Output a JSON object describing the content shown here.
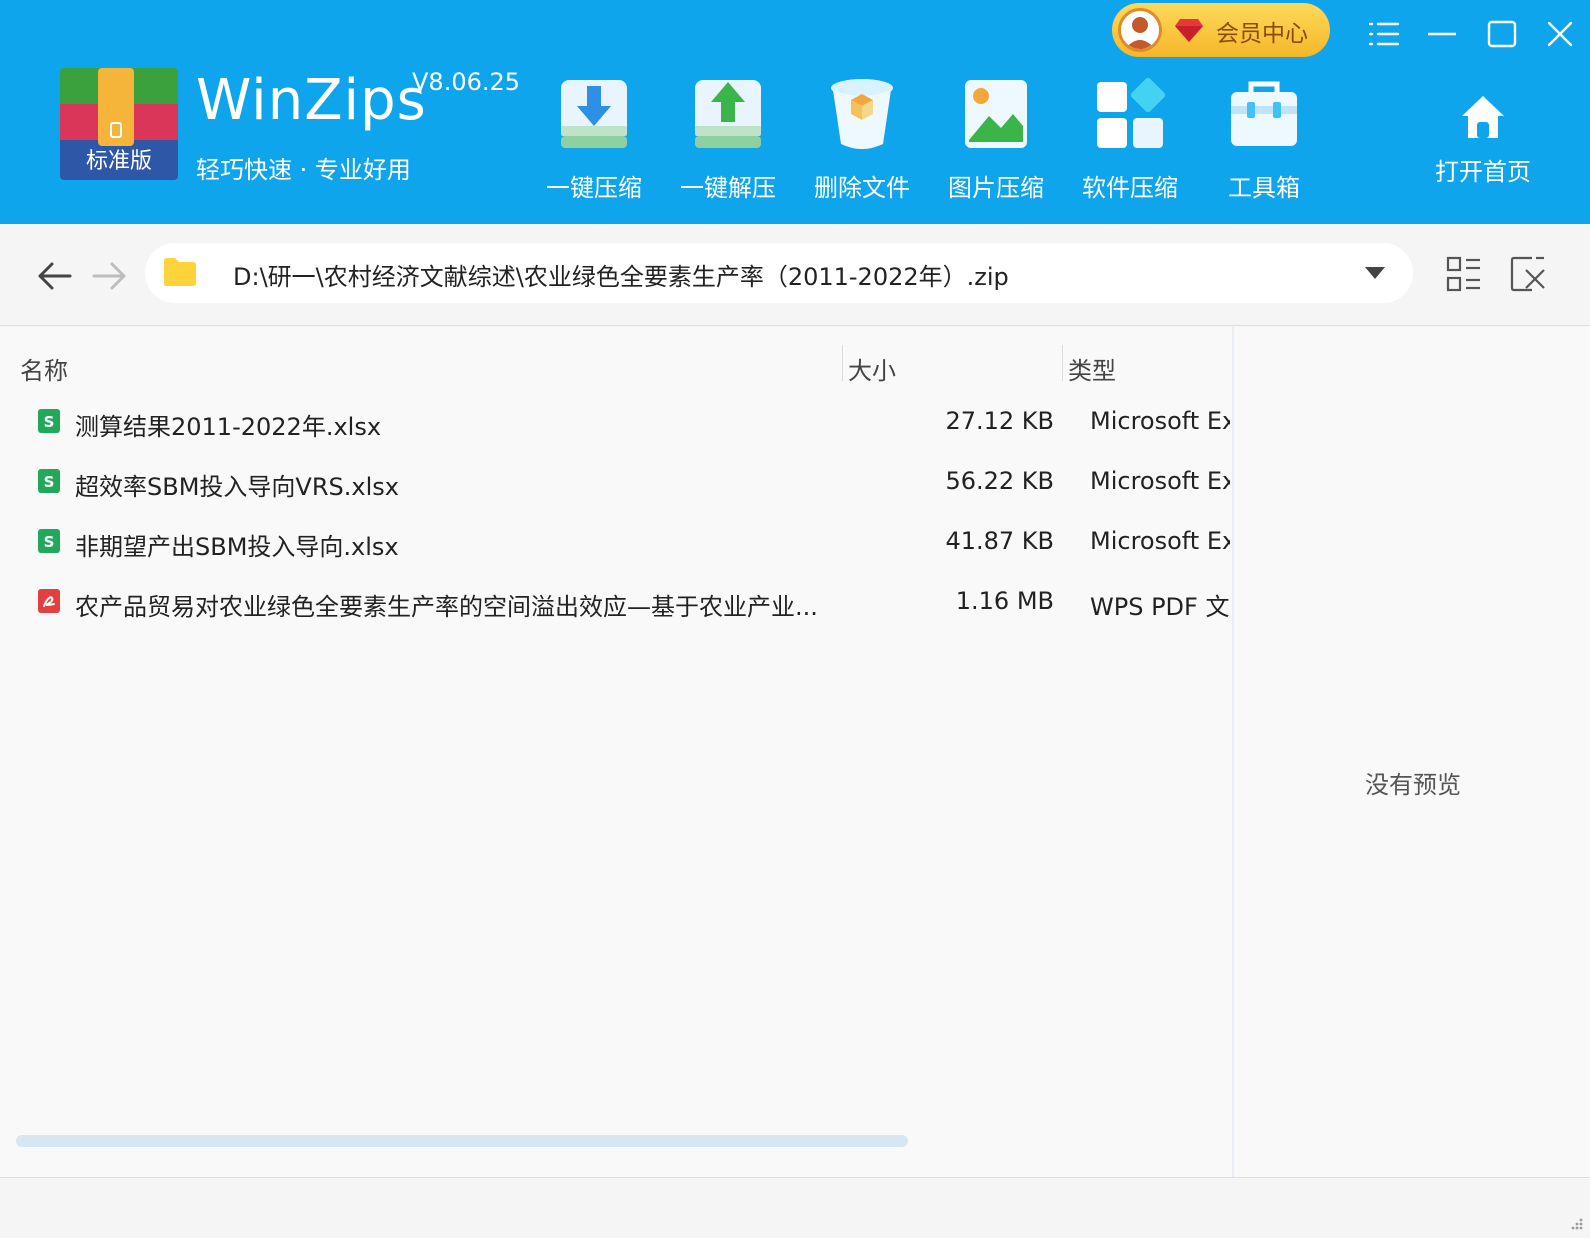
{
  "app": {
    "edition_badge": "标准版",
    "name": "WinZips",
    "version": "V8.06.25",
    "slogan": "轻巧快速 · 专业好用"
  },
  "vip": {
    "label": "会员中心"
  },
  "toolbar": {
    "compress": "一键压缩",
    "extract": "一键解压",
    "delete": "删除文件",
    "image_compress": "图片压缩",
    "software_compress": "软件压缩",
    "toolbox": "工具箱",
    "home": "打开首页"
  },
  "address": {
    "path": "D:\\研一\\农村经济文献综述\\农业绿色全要素生产率（2011-2022年）.zip"
  },
  "columns": {
    "name": "名称",
    "size": "大小",
    "type": "类型"
  },
  "files": [
    {
      "name": "测算结果2011-2022年.xlsx",
      "size": "27.12 KB",
      "type": "Microsoft Ex",
      "icon": "excel-file-icon"
    },
    {
      "name": "超效率SBM投入导向VRS.xlsx",
      "size": "56.22 KB",
      "type": "Microsoft Ex",
      "icon": "excel-file-icon"
    },
    {
      "name": "非期望产出SBM投入导向.xlsx",
      "size": "41.87 KB",
      "type": "Microsoft Ex",
      "icon": "excel-file-icon"
    },
    {
      "name": "农产品贸易对农业绿色全要素生产率的空间溢出效应—基于农业产业...",
      "size": "1.16 MB",
      "type": "WPS PDF 文",
      "icon": "pdf-file-icon"
    }
  ],
  "preview": {
    "empty_text": "没有预览"
  },
  "colors": {
    "banner": "#0ea5ec",
    "vip_gold": "#f5b729",
    "excel_green": "#21a85a",
    "pdf_red": "#e2403e"
  }
}
